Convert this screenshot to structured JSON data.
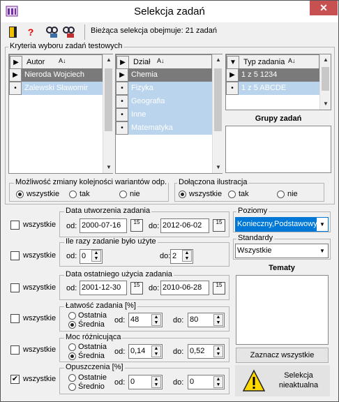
{
  "window": {
    "title": "Selekcja zadań",
    "close": "✕"
  },
  "toolbar": {
    "status": "Bieżąca selekcja obejmuje:  21 zadań"
  },
  "criteria": {
    "title": "Kryteria wyboru zadań testowych"
  },
  "authors": {
    "header": "Autor",
    "items": [
      "Nieroda Wojciech",
      "Zalewski Sławomir"
    ]
  },
  "sections": {
    "header": "Dział",
    "items": [
      "Chemia",
      "Fizyka",
      "Geografia",
      "Inne",
      "Matematyka"
    ]
  },
  "types": {
    "header": "Typ zadania",
    "items": [
      "1 z 5 1234",
      "1 z 5 ABCDE"
    ]
  },
  "groups": {
    "title": "Grupy zadań"
  },
  "order": {
    "title": "Możliwość zmiany kolejności wariantów odp.",
    "options": [
      "wszystkie",
      "tak",
      "nie"
    ],
    "selected": "wszystkie"
  },
  "illustration": {
    "title": "Dołączona ilustracja",
    "options": [
      "wszystkie",
      "tak",
      "nie"
    ],
    "selected": "wszystkie"
  },
  "filters": {
    "created": {
      "title": "Data utworzenia zadania",
      "all": "wszystkie",
      "from_label": "od:",
      "from": "2000-07-16",
      "to_label": "do:",
      "to": "2012-06-02",
      "cal": "15"
    },
    "used": {
      "title": "Ile razy zadanie było użyte",
      "all": "wszystkie",
      "from_label": "od:",
      "from": "0",
      "to_label": "do:",
      "to": "2"
    },
    "last": {
      "title": "Data ostatniego użycia zadania",
      "all": "wszystkie",
      "from_label": "od:",
      "from": "2001-12-30",
      "to_label": "do:",
      "to": "2010-06-28",
      "cal": "15"
    },
    "easy": {
      "title": "Łatwość zadania [%]",
      "all": "wszystkie",
      "opt1": "Ostatnia",
      "opt2": "Średnia",
      "from_label": "od:",
      "from": "48",
      "to_label": "do:",
      "to": "80"
    },
    "power": {
      "title": "Moc różnicująca",
      "all": "wszystkie",
      "opt1": "Ostatnia",
      "opt2": "Średnia",
      "from_label": "od:",
      "from": "0,14",
      "to_label": "do:",
      "to": "0,52"
    },
    "skip": {
      "title": "Opuszczenia [%]",
      "all": "wszystkie",
      "opt1": "Ostatnie",
      "opt2": "Średnio",
      "from_label": "od:",
      "from": "0",
      "to_label": "do:",
      "to": "0"
    }
  },
  "levels": {
    "title": "Poziomy",
    "value": "Konieczny,Podstawowy"
  },
  "standards": {
    "title": "Standardy",
    "value": "Wszystkie"
  },
  "topics": {
    "title": "Tematy",
    "select_all": "Zaznacz wszystkie"
  },
  "warning": {
    "text1": "Selekcja",
    "text2": "nieaktualna"
  },
  "colors": {
    "selected": "#7a7a7a",
    "highlight": "#b9d4ec",
    "accent": "#0078d7"
  }
}
